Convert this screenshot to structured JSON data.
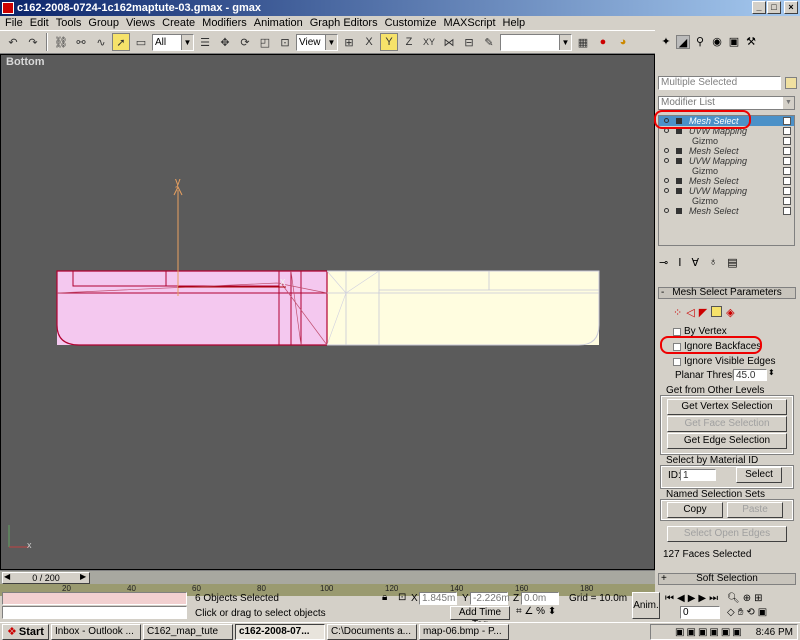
{
  "window": {
    "title": "c162-2008-0724-1c162maptute-03.gmax - gmax"
  },
  "menu": [
    "File",
    "Edit",
    "Tools",
    "Group",
    "Views",
    "Create",
    "Modifiers",
    "Animation",
    "Graph Editors",
    "Customize",
    "MAXScript",
    "Help"
  ],
  "toolbar": {
    "selection_filter": "All",
    "ref_coord": "View"
  },
  "viewport": {
    "label": "Bottom",
    "axis_y": "y",
    "axis_x": "x",
    "corner_axes": "x"
  },
  "command_panel": {
    "name_field": "Multiple Selected",
    "modifier_list": "Modifier List",
    "stack": [
      {
        "label": "Mesh Select",
        "selected": true,
        "sub": false
      },
      {
        "label": "UVW Mapping",
        "selected": false,
        "sub": false
      },
      {
        "label": "Gizmo",
        "selected": false,
        "sub": true
      },
      {
        "label": "Mesh Select",
        "selected": false,
        "sub": false
      },
      {
        "label": "UVW Mapping",
        "selected": false,
        "sub": false
      },
      {
        "label": "Gizmo",
        "selected": false,
        "sub": true
      },
      {
        "label": "Mesh Select",
        "selected": false,
        "sub": false
      },
      {
        "label": "UVW Mapping",
        "selected": false,
        "sub": false
      },
      {
        "label": "Gizmo",
        "selected": false,
        "sub": true
      },
      {
        "label": "Mesh Select",
        "selected": false,
        "sub": false
      }
    ],
    "rollout_title": "Mesh Select Parameters",
    "by_vertex": "By Vertex",
    "ignore_backfaces": "Ignore Backfaces",
    "ignore_visible_edges": "Ignore Visible Edges",
    "planar_thresh_label": "Planar Thresh:",
    "planar_thresh_value": "45.0",
    "get_from_other_levels": "Get from Other Levels",
    "get_vertex_selection": "Get Vertex Selection",
    "get_face_selection": "Get Face Selection",
    "get_edge_selection": "Get Edge Selection",
    "select_by_material_id": "Select by Material ID",
    "id_label": "ID:",
    "id_value": "1",
    "select_button": "Select",
    "named_selection_sets": "Named Selection Sets",
    "copy": "Copy",
    "paste": "Paste",
    "select_open_edges": "Select Open Edges",
    "faces_selected": "127 Faces Selected",
    "soft_selection": "Soft Selection"
  },
  "timeline": {
    "slider": "0 / 200",
    "ticks": [
      "20",
      "40",
      "60",
      "80",
      "100",
      "120",
      "140",
      "160",
      "180"
    ]
  },
  "status": {
    "objects_selected": "6 Objects Selected",
    "prompt": "Click or drag to select objects",
    "x_value": "1.845m",
    "y_value": "-2.226m",
    "z_value": "0.0m",
    "grid": "Grid = 10.0m",
    "add_time_tag": "Add Time Tag",
    "anim": "Anim.",
    "frame": "0"
  },
  "taskbar": {
    "start": "Start",
    "tasks": [
      "Inbox - Outlook ...",
      "C162_map_tute",
      "c162-2008-07...",
      "C:\\Documents a...",
      "map-06.bmp - P..."
    ],
    "active_index": 2,
    "clock": "8:46 PM"
  },
  "colors": {
    "pink_faces": "#f4c8ef",
    "yellow_faces": "#fffde0",
    "viewport_bg": "#5b5b5b",
    "selection_blue": "#4b91c8",
    "highlight_red": "#e00000"
  }
}
